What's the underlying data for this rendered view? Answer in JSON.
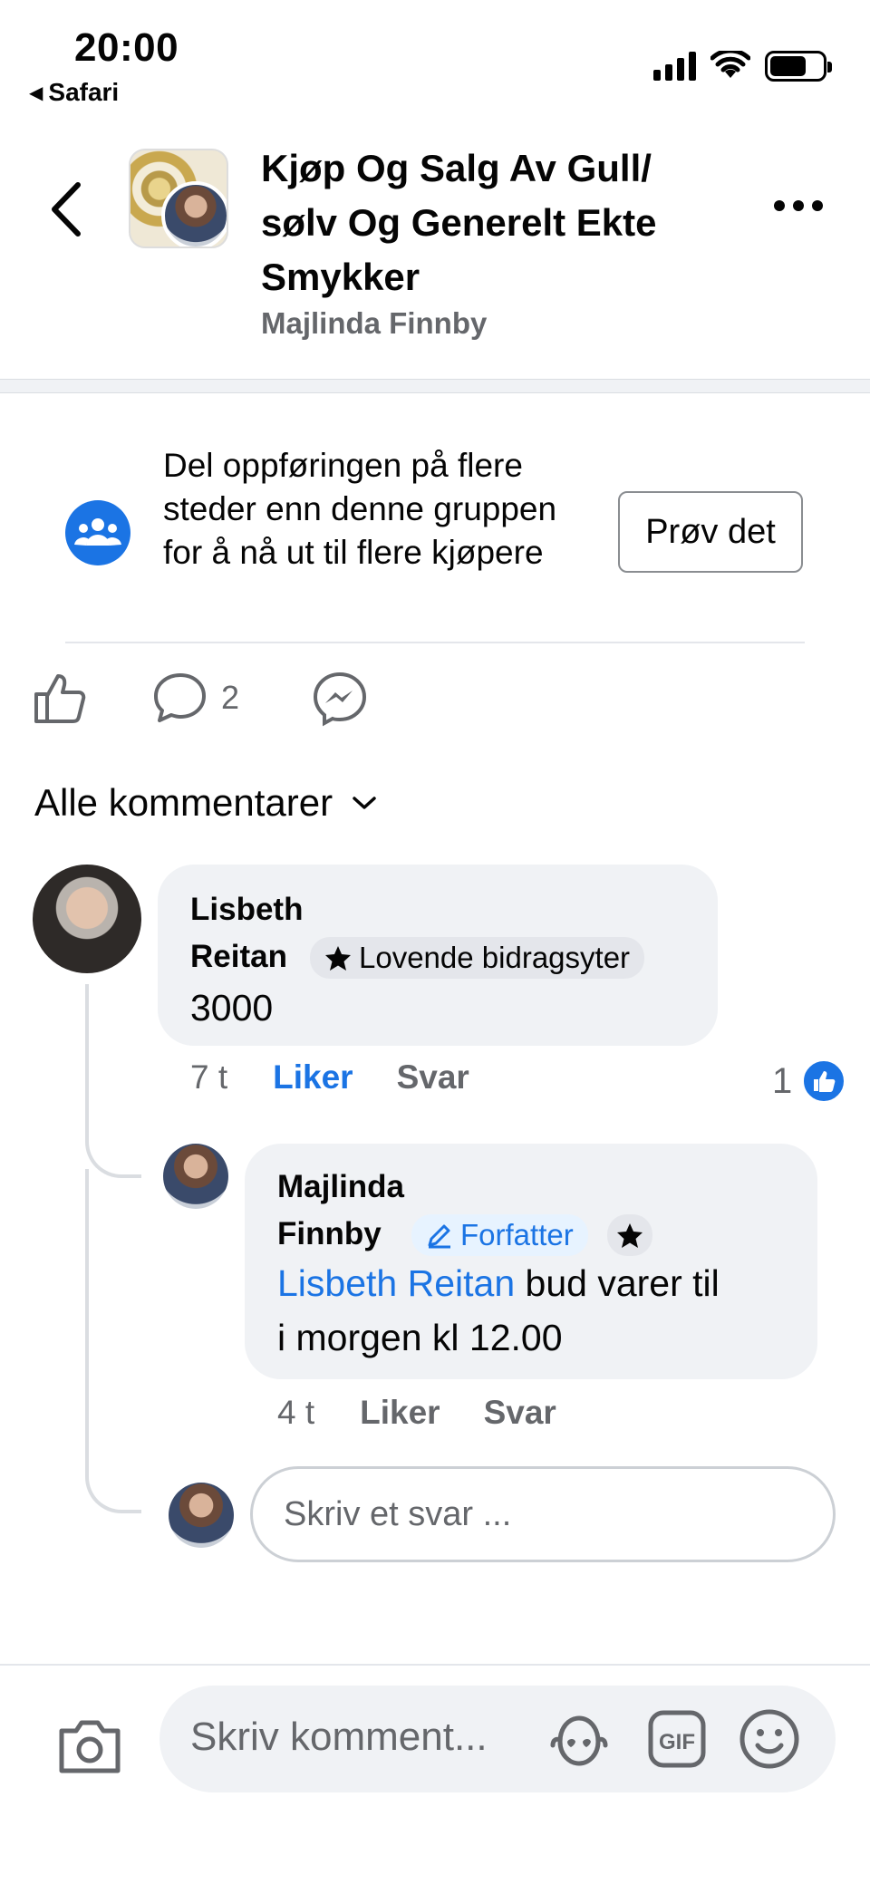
{
  "status": {
    "time": "20:00",
    "back_app": "Safari"
  },
  "header": {
    "title": "Kjøp Og Salg Av Gull/ sølv Og Generelt Ekte Smykker",
    "subtitle": "Majlinda Finnby"
  },
  "promo": {
    "text": "Del oppføringen på flere steder enn denne gruppen for å nå ut til flere kjøpere",
    "button": "Prøv det"
  },
  "actions": {
    "comment_count": "2"
  },
  "comments_filter": {
    "label": "Alle kommentarer"
  },
  "comments": [
    {
      "name_line1": "Lisbeth",
      "name_line2": "Reitan",
      "badge": "Lovende bidragsyter",
      "text": "3000",
      "time": "7 t",
      "like_label": "Liker",
      "reply_label": "Svar",
      "like_count": "1"
    },
    {
      "name_line1": "Majlinda",
      "name_line2": "Finnby",
      "badge": "Forfatter",
      "mention": "Lisbeth Reitan",
      "text_line1": " bud varer til",
      "text_line2": "i morgen kl 12.00",
      "time": "4 t",
      "like_label": "Liker",
      "reply_label": "Svar"
    }
  ],
  "reply_input": {
    "placeholder": "Skriv et svar ..."
  },
  "composer": {
    "placeholder": "Skriv komment..."
  },
  "colors": {
    "accent": "#1b74e4",
    "bubble": "#f0f2f5",
    "muted": "#65676b"
  },
  "icons": [
    "back-chevron-icon",
    "more-icon",
    "group-icon",
    "like-icon",
    "comment-icon",
    "messenger-icon",
    "chevron-down-icon",
    "star-icon",
    "pencil-icon",
    "like-reaction-icon",
    "camera-icon",
    "avatar-sticker-icon",
    "gif-icon",
    "emoji-icon"
  ]
}
